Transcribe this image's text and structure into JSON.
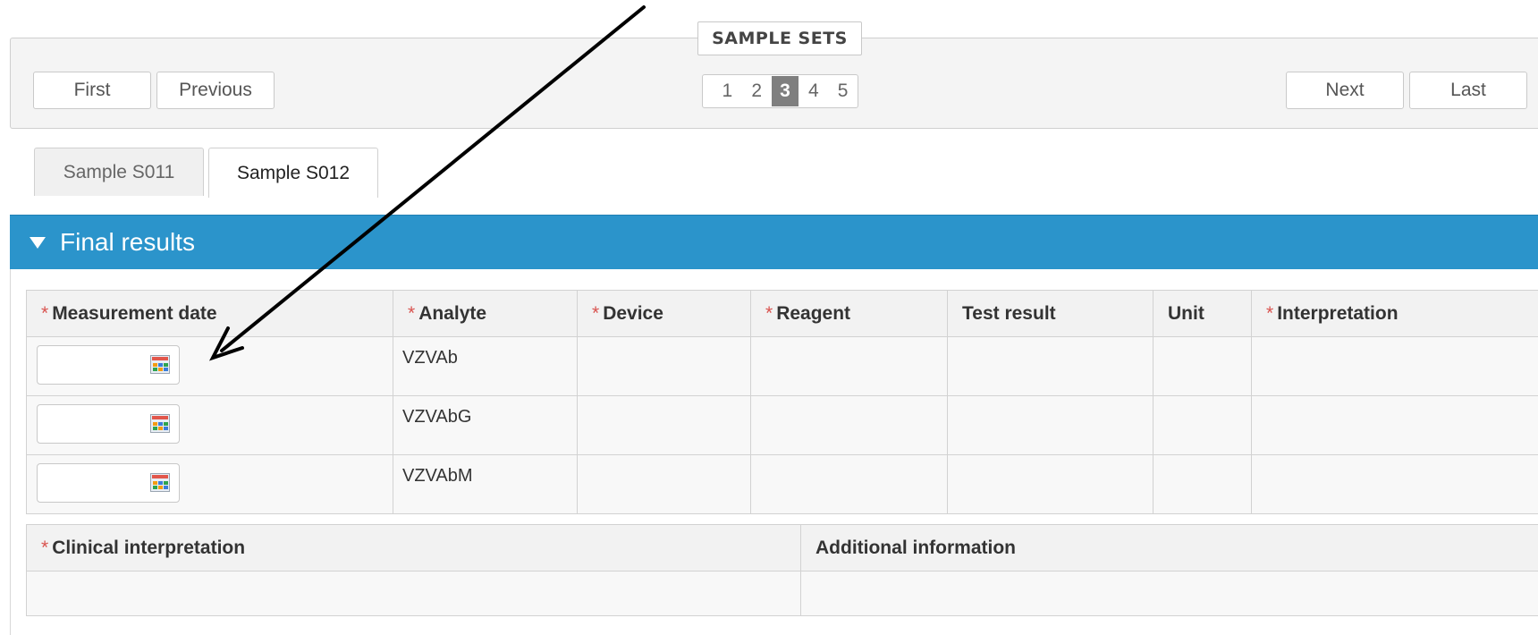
{
  "pager": {
    "legend": "SAMPLE SETS",
    "first_label": "First",
    "previous_label": "Previous",
    "next_label": "Next",
    "last_label": "Last",
    "pages": [
      "1",
      "2",
      "3",
      "4",
      "5"
    ],
    "current_page": "3"
  },
  "tabs": [
    {
      "label": "Sample S011",
      "active": false
    },
    {
      "label": "Sample S012",
      "active": true
    }
  ],
  "panel": {
    "title": "Final results",
    "results_table": {
      "required_mark": "*",
      "headers": [
        {
          "label": "Measurement date",
          "required": true
        },
        {
          "label": "Analyte",
          "required": true
        },
        {
          "label": "Device",
          "required": true
        },
        {
          "label": "Reagent",
          "required": true
        },
        {
          "label": "Test result",
          "required": false
        },
        {
          "label": "Unit",
          "required": false
        },
        {
          "label": "Interpretation",
          "required": true
        }
      ],
      "rows": [
        {
          "measurement_date": "",
          "analyte": "VZVAb",
          "device": "",
          "reagent": "",
          "test_result": "",
          "unit": "",
          "interpretation": ""
        },
        {
          "measurement_date": "",
          "analyte": "VZVAbG",
          "device": "",
          "reagent": "",
          "test_result": "",
          "unit": "",
          "interpretation": ""
        },
        {
          "measurement_date": "",
          "analyte": "VZVAbM",
          "device": "",
          "reagent": "",
          "test_result": "",
          "unit": "",
          "interpretation": ""
        }
      ]
    },
    "info_table": {
      "headers": [
        {
          "label": "Clinical interpretation",
          "required": true
        },
        {
          "label": "Additional information",
          "required": false
        }
      ],
      "values": [
        "",
        ""
      ]
    }
  },
  "icons": {
    "panel_toggle": "triangle-down-icon",
    "date_picker": "calendar-icon",
    "annotation": "annotation-arrow"
  },
  "colors": {
    "panel_header": "#2b94cb",
    "required_asterisk": "#d9534f",
    "active_page": "#7f7f7f"
  }
}
